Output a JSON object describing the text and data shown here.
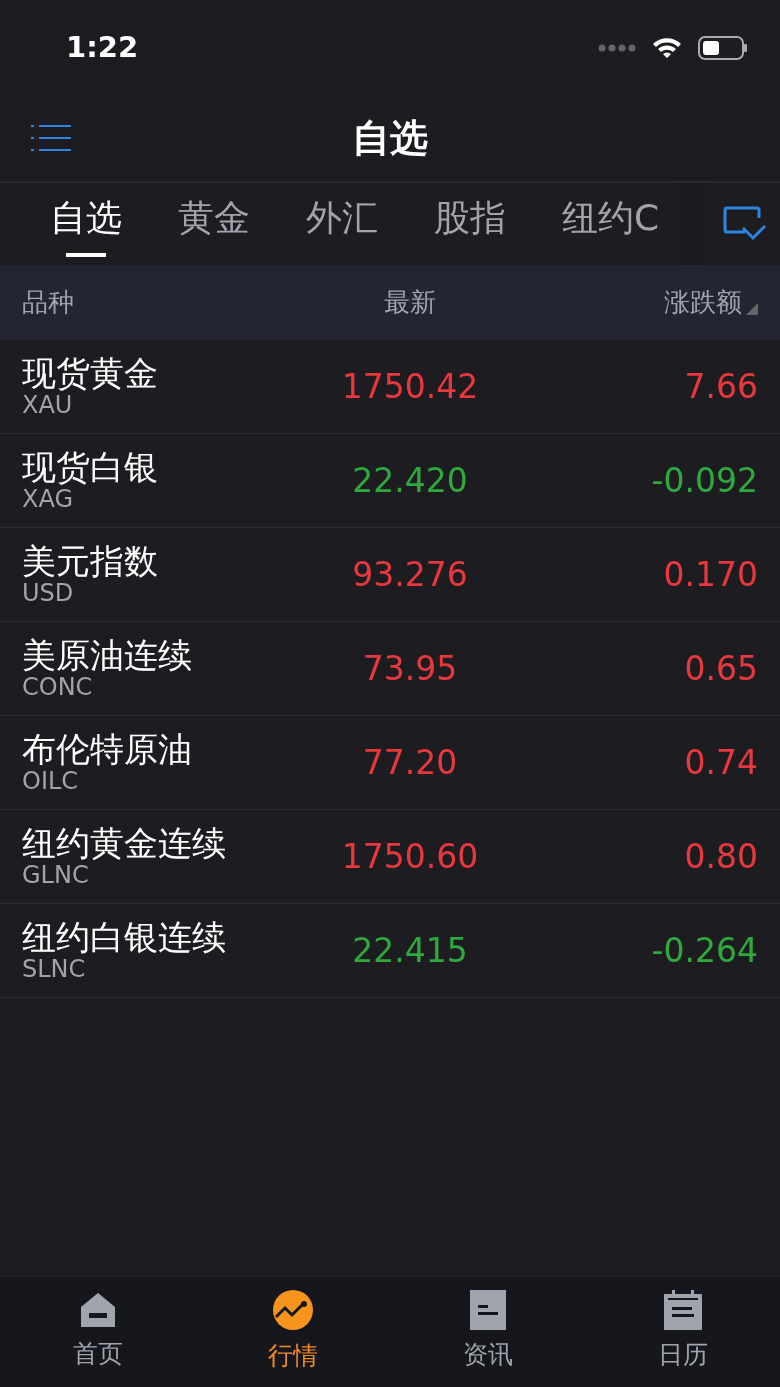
{
  "status_bar": {
    "time": "1:22"
  },
  "nav_bar": {
    "title": "自选"
  },
  "tabs": [
    {
      "label": "自选",
      "selected": true
    },
    {
      "label": "黄金",
      "selected": false
    },
    {
      "label": "外汇",
      "selected": false
    },
    {
      "label": "股指",
      "selected": false
    },
    {
      "label": "纽约C",
      "selected": false
    }
  ],
  "table": {
    "columns": [
      "品种",
      "最新",
      "涨跌额"
    ],
    "rows": [
      {
        "name": "现货黄金",
        "code": "XAU",
        "last": "1750.42",
        "change": "7.66",
        "color": "#e8383d"
      },
      {
        "name": "现货白银",
        "code": "XAG",
        "last": "22.420",
        "change": "-0.092",
        "color": "#2eaa3c"
      },
      {
        "name": "美元指数",
        "code": "USD",
        "last": "93.276",
        "change": "0.170",
        "color": "#e8383d"
      },
      {
        "name": "美原油连续",
        "code": "CONC",
        "last": "73.95",
        "change": "0.65",
        "color": "#e8383d"
      },
      {
        "name": "布伦特原油",
        "code": "OILC",
        "last": "77.20",
        "change": "0.74",
        "color": "#e8383d"
      },
      {
        "name": "纽约黄金连续",
        "code": "GLNC",
        "last": "1750.60",
        "change": "0.80",
        "color": "#e8383d"
      },
      {
        "name": "纽约白银连续",
        "code": "SLNC",
        "last": "22.415",
        "change": "-0.264",
        "color": "#2eaa3c"
      }
    ]
  },
  "bottom_nav": [
    {
      "label": "首页",
      "kind": "home",
      "selected": false
    },
    {
      "label": "行情",
      "kind": "chart",
      "selected": true
    },
    {
      "label": "资讯",
      "kind": "news",
      "selected": false
    },
    {
      "label": "日历",
      "kind": "calendar",
      "selected": false
    }
  ]
}
